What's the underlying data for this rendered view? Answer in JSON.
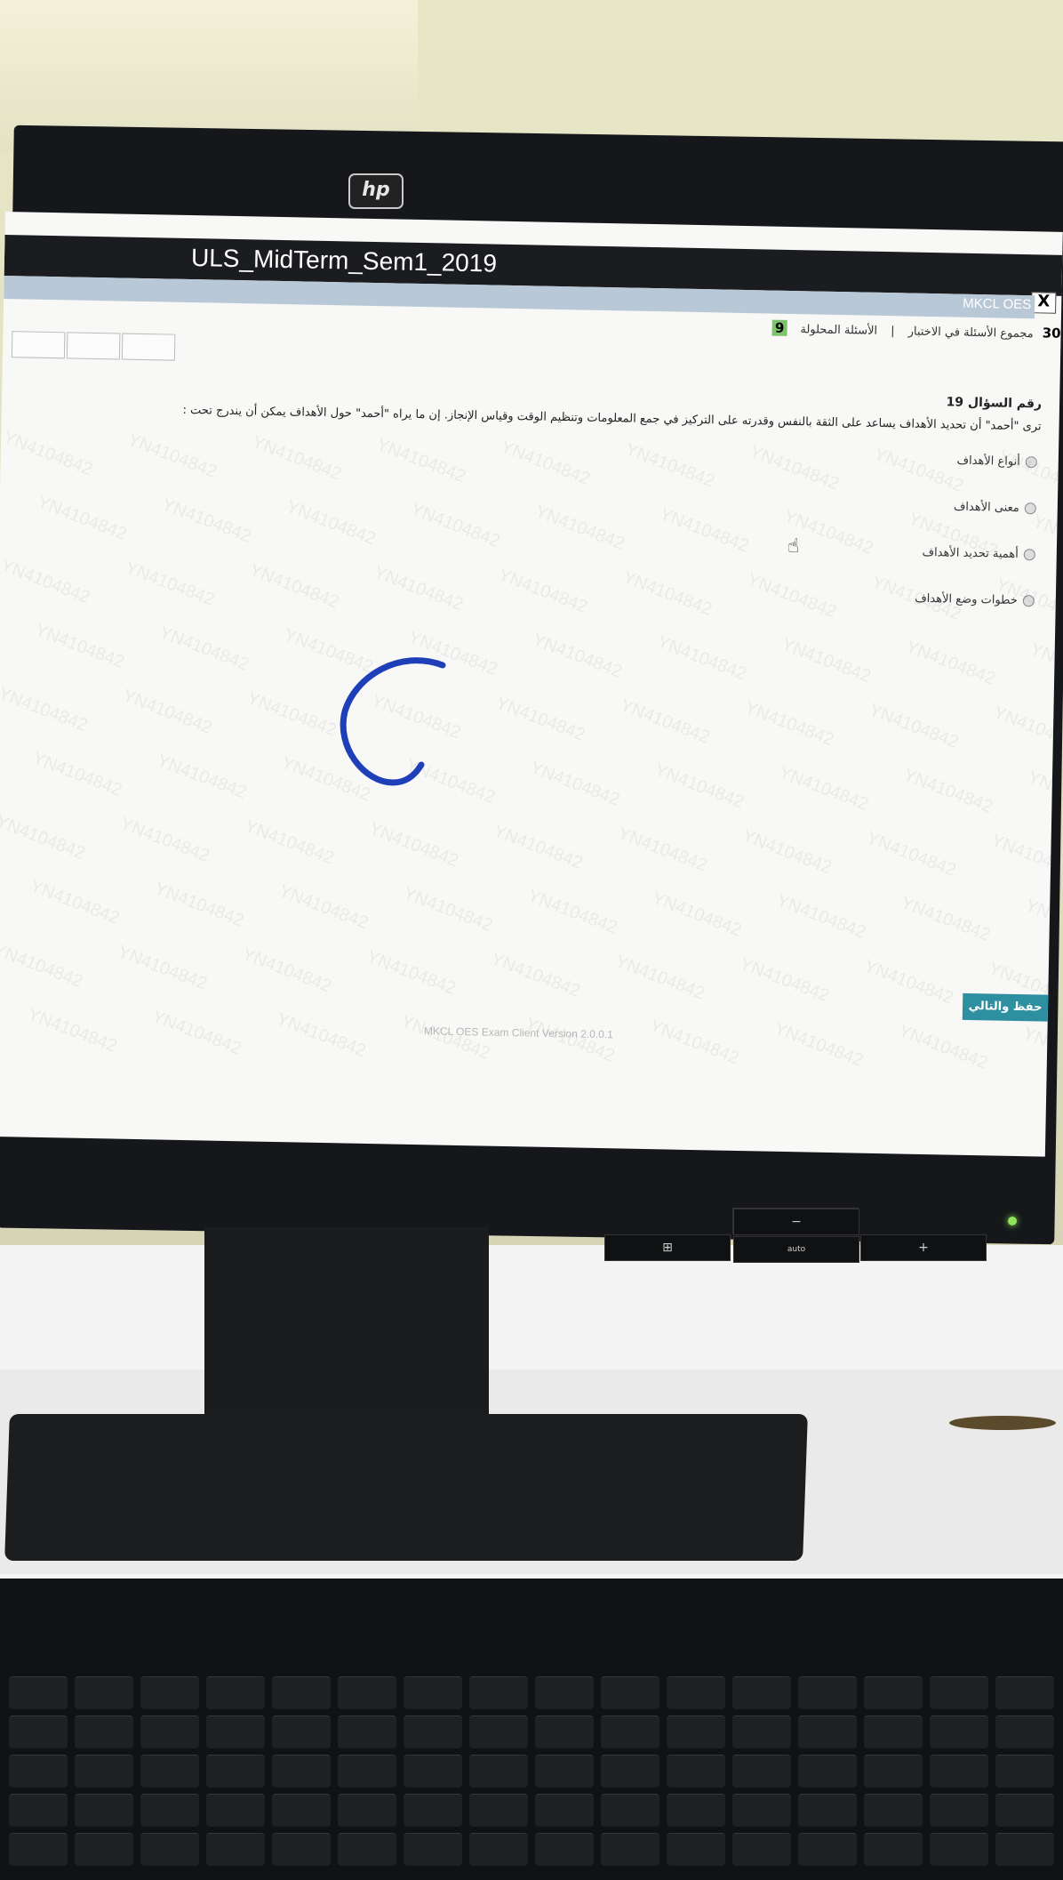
{
  "window": {
    "title": "ULS_MidTerm_Sem1_2019",
    "close_label": "X",
    "brand": "MKCL OES"
  },
  "info": {
    "total_label": "مجموع الأسئلة في الاختبار",
    "total_value": "30",
    "answered_label": "الأسئلة المحلولة",
    "answered_value": "9"
  },
  "question": {
    "number_label": "رقم السؤال",
    "number_value": "19",
    "text": "ترى \"أحمد\" أن تحديد الأهداف يساعد على الثقة بالنفس وقدرته على التركيز في جمع المعلومات وتنظيم الوقت وقياس الإنجاز. إن ما يراه \"أحمد\" حول الأهداف يمكن أن يندرج تحت :",
    "options": [
      "أنواع الأهداف",
      "معنى الأهداف",
      "أهمية تحديد الأهداف",
      "خطوات وضع الأهداف"
    ]
  },
  "watermark_text": "YN4104842",
  "next_button": "حفظ والتالي",
  "footer": "MKCL OES Exam Client Version 2.0.0.1",
  "monitor": {
    "logo": "hp",
    "bezel_buttons": [
      "⊞",
      "−",
      "+"
    ],
    "bezel_auto": "auto"
  }
}
